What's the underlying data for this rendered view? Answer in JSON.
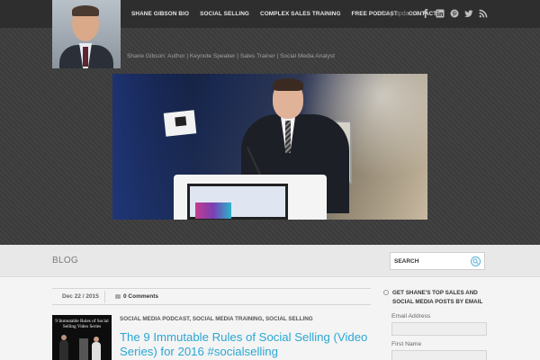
{
  "header": {
    "nav": [
      {
        "label": "SHANE GIBSON BIO"
      },
      {
        "label": "SOCIAL SELLING"
      },
      {
        "label": "COMPLEX SALES TRAINING"
      },
      {
        "label": "FREE PODCAST"
      },
      {
        "label": "CONTACT"
      }
    ],
    "stay_updated": "Stay updated:",
    "social_icons": [
      "facebook-icon",
      "linkedin-icon",
      "pinterest-icon",
      "twitter-icon",
      "rss-icon"
    ],
    "tagline": "Shane Gibson: Author | Keynote Speaker | Sales Trainer | Social Media Analyst"
  },
  "blogbar": {
    "title": "BLOG",
    "search_placeholder": "SEARCH"
  },
  "post": {
    "date": "Dec 22 / 2015",
    "comments": "0 Comments",
    "thumb_caption": "9 Immutable Rules of Social Selling Video Series",
    "categories": "SOCIAL MEDIA PODCAST, SOCIAL MEDIA TRAINING, SOCIAL SELLING",
    "title": "The 9 Immutable Rules of Social Selling (Video Series) for 2016 #socialselling"
  },
  "sidebar": {
    "widget_title": "GET SHANE'S TOP SALES AND SOCIAL MEDIA POSTS BY EMAIL",
    "email_label": "Email Address",
    "firstname_label": "First Name"
  },
  "colors": {
    "accent": "#2ba7d3",
    "header_bg": "#3d3d3d",
    "topbar_bg": "#2e2e2e"
  }
}
